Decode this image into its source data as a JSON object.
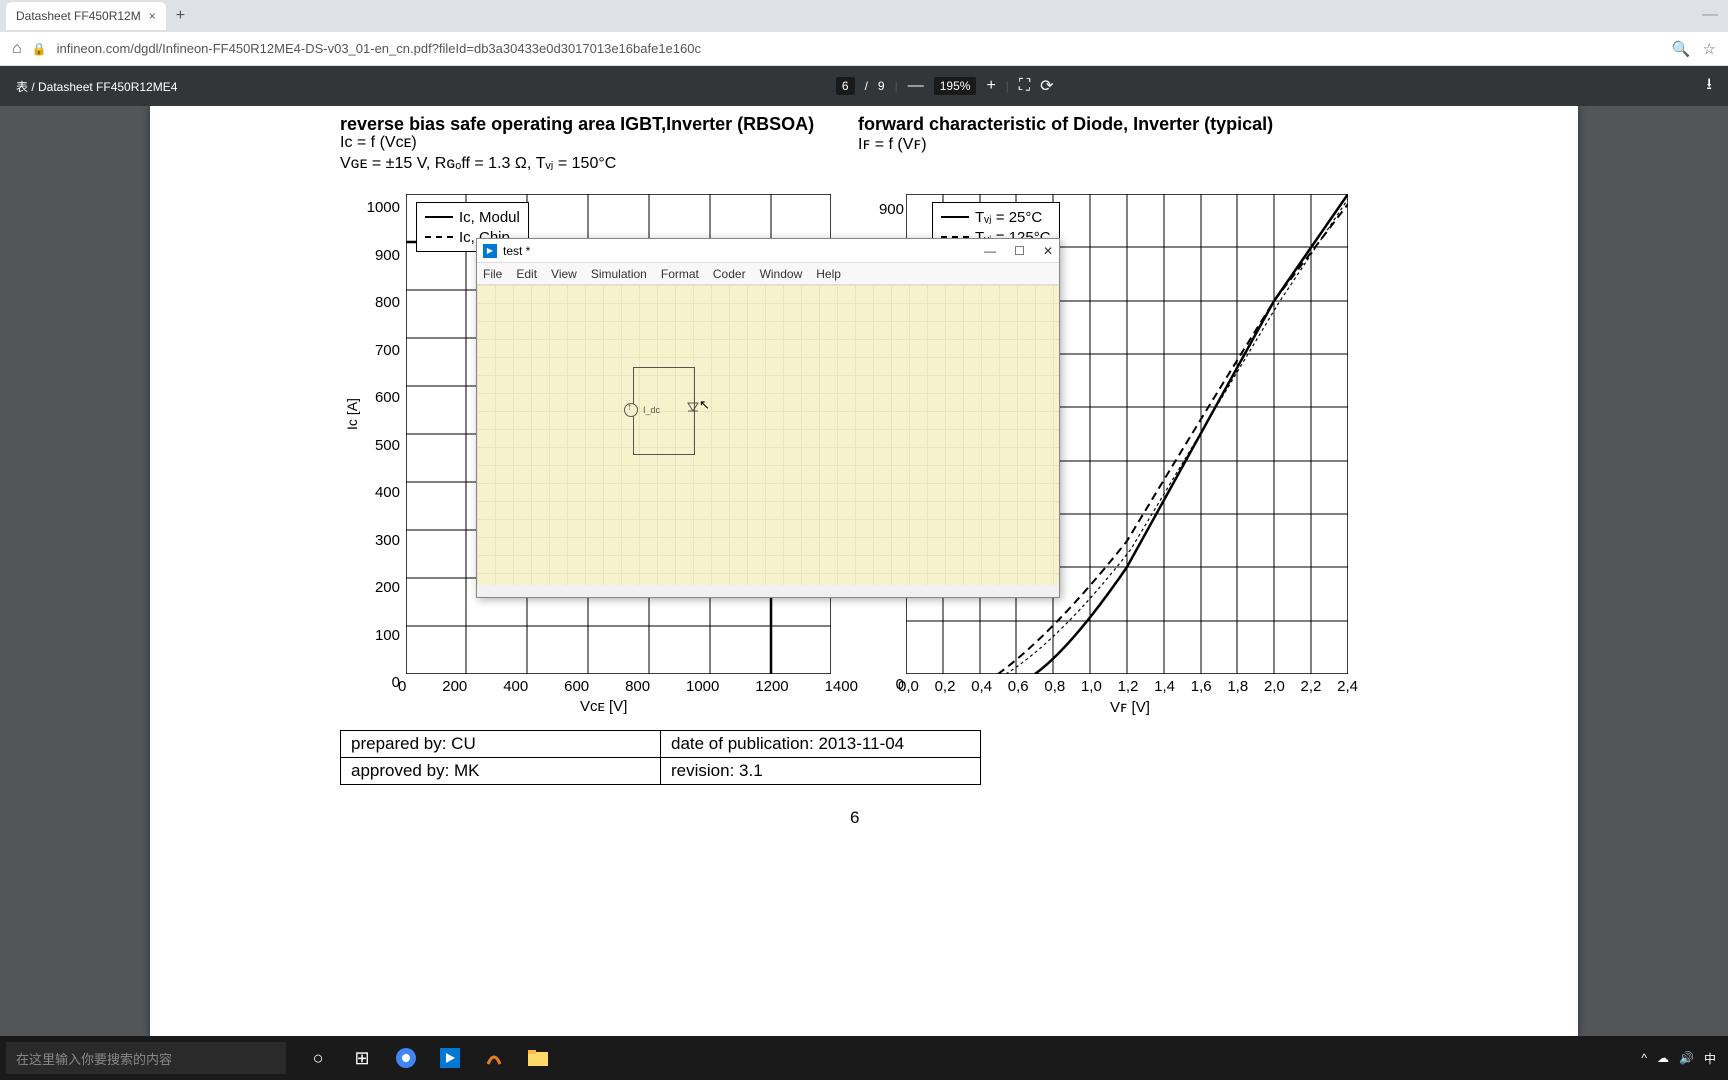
{
  "browser": {
    "tab_title": "Datasheet FF450R12M",
    "url": "infineon.com/dgdl/Infineon-FF450R12ME4-DS-v03_01-en_cn.pdf?fileId=db3a30433e0d3017013e16bafe1e160c"
  },
  "pdf_toolbar": {
    "title": "表 / Datasheet FF450R12ME4",
    "page_current": "6",
    "page_total": "9",
    "zoom": "195%"
  },
  "chart_left": {
    "title": "reverse bias safe operating area IGBT,Inverter (RBSOA)",
    "sub1": "Iᴄ = f (Vᴄᴇ)",
    "sub2": "Vɢᴇ = ±15 V, Rɢₒff = 1.3 Ω, Tᵥⱼ = 150°C",
    "ylabel": "Iᴄ [A]",
    "xlabel": "Vᴄᴇ  [V]",
    "y_ticks": [
      "1000",
      "900",
      "800",
      "700",
      "600",
      "500",
      "400",
      "300",
      "200",
      "100",
      "0"
    ],
    "x_ticks": [
      "0",
      "200",
      "400",
      "600",
      "800",
      "1000",
      "1200",
      "1400"
    ],
    "legend": [
      "Iᴄ, Modul",
      "Iᴄ, Chip"
    ]
  },
  "chart_right": {
    "title": "forward characteristic of Diode, Inverter (typical)",
    "sub1": "Iꜰ = f (Vꜰ)",
    "xlabel": "Vꜰ [V]",
    "y_ticks": [
      "900",
      "",
      "",
      "",
      "",
      "",
      "",
      "",
      "",
      "0"
    ],
    "x_ticks": [
      "0,0",
      "0,2",
      "0,4",
      "0,6",
      "0,8",
      "1,0",
      "1,2",
      "1,4",
      "1,6",
      "1,8",
      "2,0",
      "2,2",
      "2,4"
    ],
    "legend": [
      "Tᵥⱼ = 25°C",
      "Tᵥⱼ = 125°C"
    ]
  },
  "meta": {
    "prepared": "prepared by: CU",
    "approved": "approved by: MK",
    "date": "date of publication: 2013-11-04",
    "rev": "revision: 3.1",
    "page": "6"
  },
  "sim": {
    "title": "test *",
    "menus": [
      "File",
      "Edit",
      "View",
      "Simulation",
      "Format",
      "Coder",
      "Window",
      "Help"
    ],
    "source_label": "I_dc"
  },
  "taskbar": {
    "search_placeholder": "在这里输入你要搜索的内容"
  },
  "chart_data": [
    {
      "type": "line",
      "title": "reverse bias safe operating area IGBT,Inverter (RBSOA)",
      "xlabel": "VCE [V]",
      "ylabel": "IC [A]",
      "xlim": [
        0,
        1400
      ],
      "ylim": [
        0,
        1000
      ],
      "series": [
        {
          "name": "IC, Modul",
          "x": [
            0,
            900,
            1200,
            1200
          ],
          "y": [
            900,
            900,
            700,
            0
          ]
        },
        {
          "name": "IC, Chip",
          "x": [
            0,
            1200,
            1200
          ],
          "y": [
            900,
            900,
            0
          ]
        }
      ]
    },
    {
      "type": "line",
      "title": "forward characteristic of Diode, Inverter (typical)",
      "xlabel": "VF [V]",
      "ylabel": "IF [A]",
      "xlim": [
        0,
        2.4
      ],
      "ylim": [
        0,
        900
      ],
      "series": [
        {
          "name": "Tvj = 25°C",
          "x": [
            0.7,
            0.9,
            1.2,
            1.6,
            2.0,
            2.4
          ],
          "y": [
            0,
            50,
            200,
            450,
            700,
            900
          ]
        },
        {
          "name": "Tvj = 125°C",
          "x": [
            0.5,
            0.8,
            1.2,
            1.6,
            2.0,
            2.4
          ],
          "y": [
            0,
            70,
            250,
            480,
            700,
            880
          ]
        }
      ]
    }
  ]
}
